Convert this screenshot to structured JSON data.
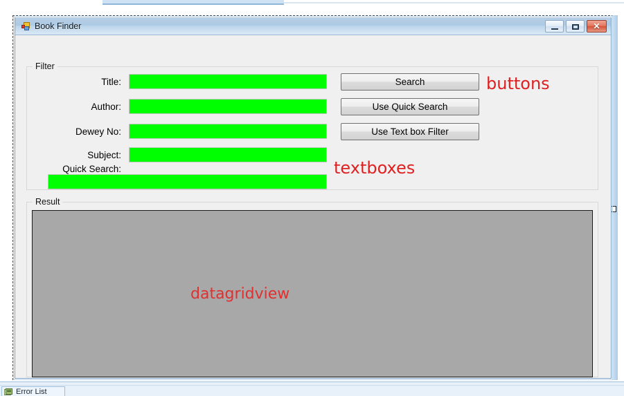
{
  "window": {
    "title": "Book Finder",
    "icon": "form-designer-icon",
    "controls": {
      "minimize": "minimize-icon",
      "maximize": "maximize-icon",
      "close": "close-icon",
      "close_glyph": "✕"
    }
  },
  "filter_group": {
    "label": "Filter",
    "fields": [
      {
        "label": "Title:",
        "value": "",
        "placeholder": "",
        "name": "title"
      },
      {
        "label": "Author:",
        "value": "",
        "placeholder": "",
        "name": "author"
      },
      {
        "label": "Dewey No:",
        "value": "",
        "placeholder": "",
        "name": "dewey-no"
      },
      {
        "label": "Subject:",
        "value": "",
        "placeholder": "",
        "name": "subject"
      },
      {
        "label": "Quick Search:",
        "value": "",
        "placeholder": "",
        "name": "quick-search"
      }
    ],
    "buttons": [
      {
        "label": "Search",
        "name": "search"
      },
      {
        "label": "Use Quick Search",
        "name": "use-quick-search"
      },
      {
        "label": "Use Text box Filter",
        "name": "use-text-box-filter"
      }
    ]
  },
  "result_group": {
    "label": "Result",
    "grid_placeholder": "datagridview"
  },
  "annotations": {
    "buttons": "buttons",
    "textboxes": "textboxes",
    "datagridview": "datagridview"
  },
  "ide": {
    "bottom_panel_tab": "Error List"
  },
  "colors": {
    "textbox_fill": "#00ff00",
    "annotation_red": "#e02020",
    "grid_fill": "#a8a8a8",
    "titlebar_blue": "#accae4",
    "close_red": "#d3543b"
  }
}
